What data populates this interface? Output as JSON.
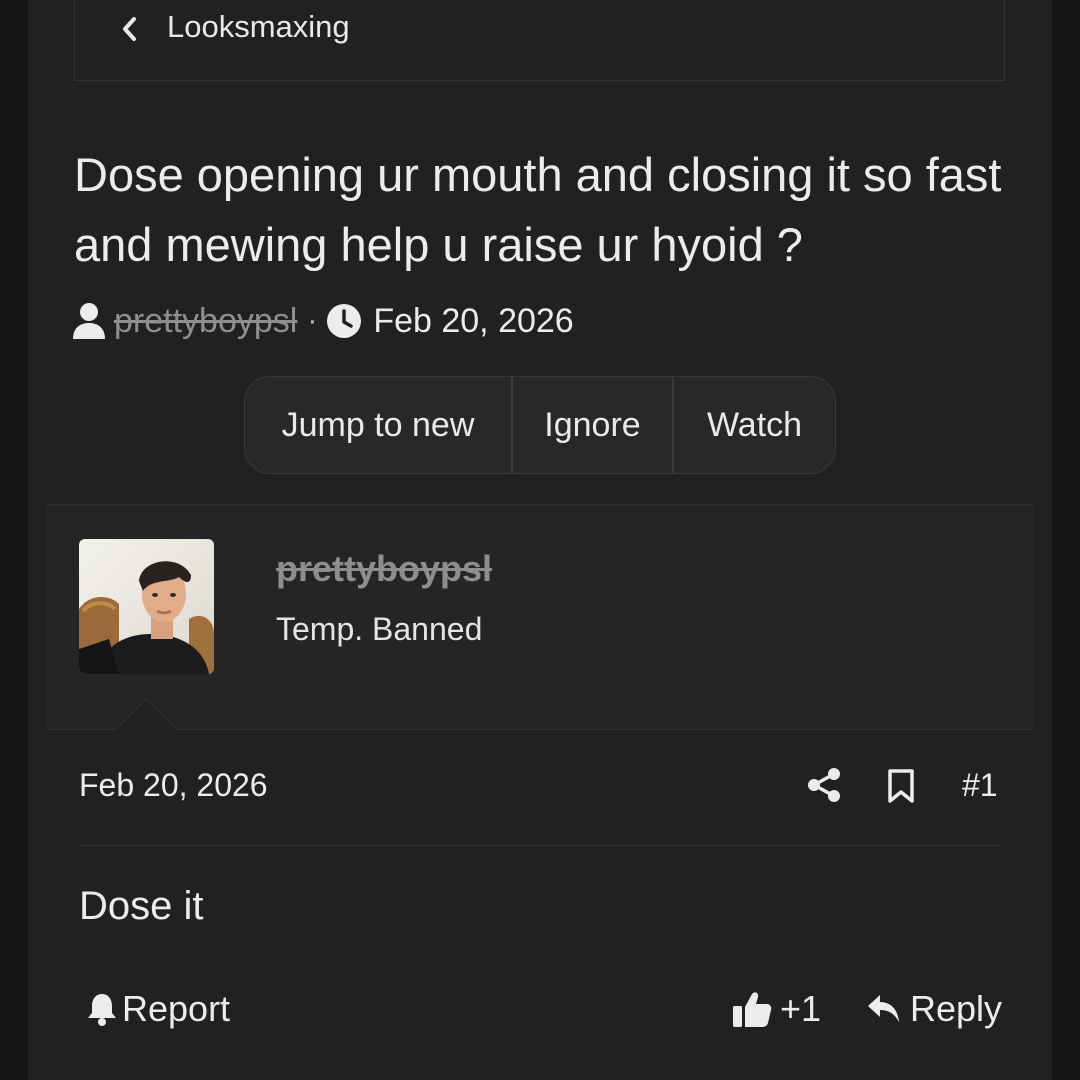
{
  "breadcrumb": {
    "label": "Looksmaxing",
    "icon": "chevron-left-icon"
  },
  "thread": {
    "title": "Dose opening ur mouth and closing it so fast and mewing help u raise ur hyoid ?",
    "author": "prettyboypsl",
    "separator": "·",
    "date": "Feb 20, 2026"
  },
  "thread_actions": {
    "jump_label": "Jump to new",
    "ignore_label": "Ignore",
    "watch_label": "Watch"
  },
  "post": {
    "author_name": "prettyboypsl",
    "author_title": "Temp. Banned",
    "date": "Feb 20, 2026",
    "number": "#1",
    "body": "Dose it",
    "report_label": "Report",
    "reaction_count": "+1",
    "reply_label": "Reply"
  },
  "colors": {
    "background": "#212121",
    "outer_background": "#151515",
    "text": "#ececec",
    "muted_strikethrough": "#8e8e8e",
    "border": "#3a3a3a"
  }
}
